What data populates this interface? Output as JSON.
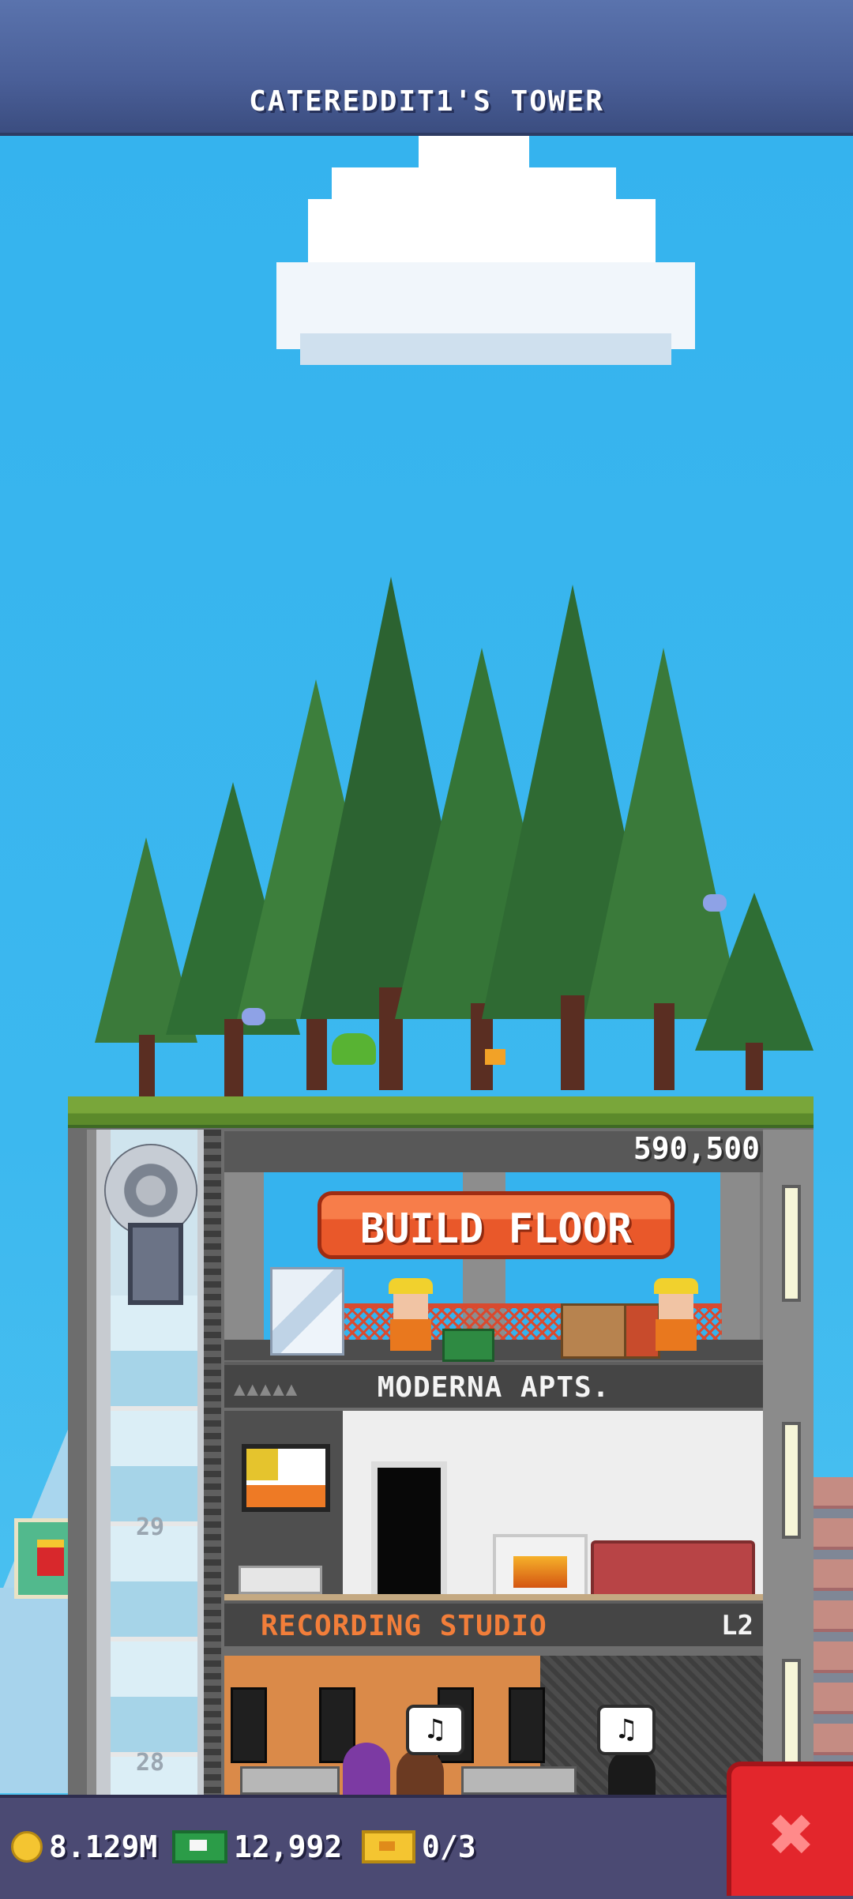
{
  "header": {
    "title": "CATEREDDIT1'S TOWER"
  },
  "construction": {
    "cost": "590,500",
    "build_label": "BUILD FLOOR"
  },
  "floors": [
    {
      "name": "MODERNA APTS.",
      "type": "apartment",
      "stars": "▲▲▲▲▲"
    },
    {
      "name": "RECORDING STUDIO",
      "type": "creative",
      "level": "L2"
    }
  ],
  "elevator": {
    "floor_labels": [
      "29",
      "28"
    ]
  },
  "hud": {
    "coins": "8.129M",
    "bux": "12,992",
    "tickets": "0/3"
  },
  "icons": {
    "coin": "coin-icon",
    "bux": "cash-icon",
    "tickets": "ticket-icon",
    "close": "close-icon",
    "music": "music-note-icon"
  },
  "bubbles": [
    "♫",
    "♫"
  ],
  "colors": {
    "accent": "#e9582a",
    "close": "#e3262c",
    "sky": "#39b6ee",
    "studio_label": "#f27e3a"
  }
}
